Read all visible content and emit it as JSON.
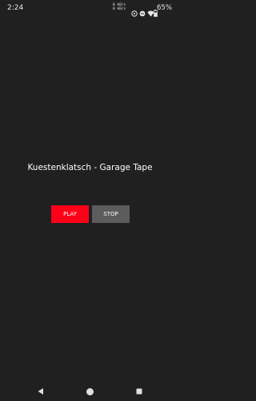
{
  "status_bar": {
    "time": "2:24",
    "net_speed_up": "0 kB/s",
    "net_speed_down": "0 kB/s",
    "battery_percent": "65%",
    "icons": [
      "notification-icon",
      "dnd-icon",
      "wifi-icon",
      "battery-icon"
    ]
  },
  "main": {
    "title": "Kuestenklatsch - Garage Tape",
    "play_label": "PLAY",
    "stop_label": "STOP"
  },
  "nav_bar": {
    "icons": [
      "back-icon",
      "home-icon",
      "recents-icon"
    ]
  },
  "colors": {
    "background": "#202020",
    "play": "#ff0019",
    "stop": "#5c5c5c",
    "text": "#ffffff"
  }
}
